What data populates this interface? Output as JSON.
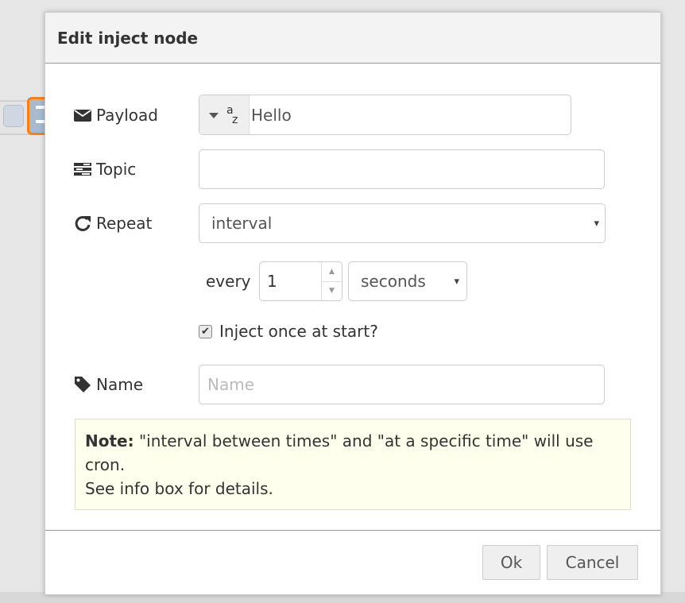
{
  "dialog": {
    "title": "Edit inject node"
  },
  "payload": {
    "label": "Payload",
    "icon": "envelope-icon",
    "type_icon": "az",
    "type_a": "a",
    "type_z": "z",
    "value": "Hello"
  },
  "topic": {
    "label": "Topic",
    "icon": "tasks-icon",
    "value": ""
  },
  "repeat": {
    "label": "Repeat",
    "icon": "repeat-icon",
    "selected": "interval",
    "arrow": "▾"
  },
  "interval": {
    "every_label": "every",
    "value": "1",
    "unit": "seconds",
    "arrow": "▾"
  },
  "once": {
    "checked": true,
    "check_glyph": "✔",
    "label": "Inject once at start?"
  },
  "name": {
    "label": "Name",
    "icon": "tag-icon",
    "placeholder": "Name",
    "value": ""
  },
  "note": {
    "bold": "Note:",
    "line1": " \"interval between times\" and \"at a specific time\" will use cron.",
    "line2": "See info box for details."
  },
  "footer": {
    "ok_label": "Ok",
    "cancel_label": "Cancel"
  },
  "colors": {
    "selection_accent": "#ff7f0e",
    "note_background": "#ffffee"
  }
}
